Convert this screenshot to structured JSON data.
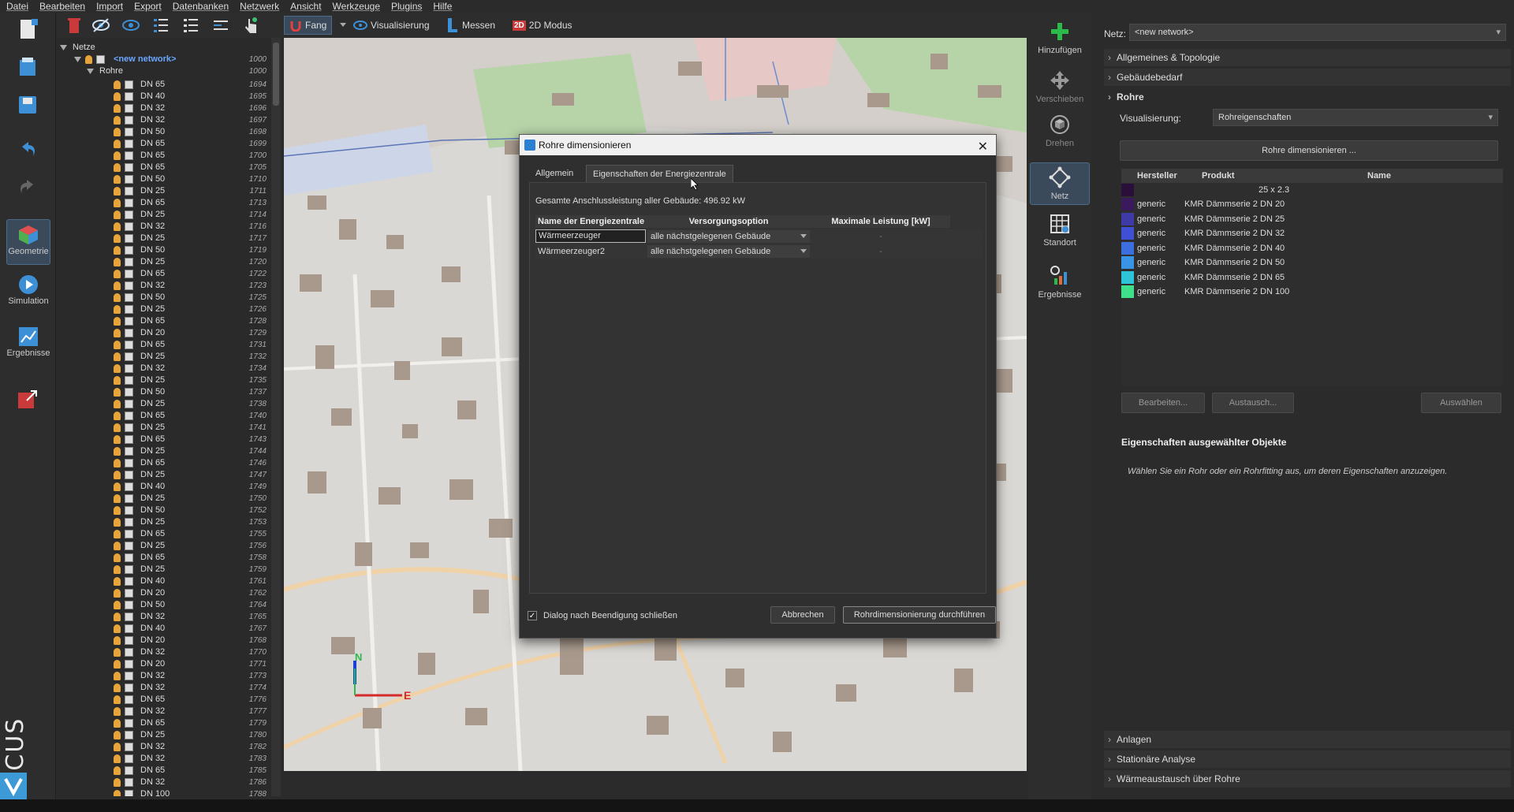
{
  "menu": [
    "Datei",
    "Bearbeiten",
    "Import",
    "Export",
    "Datenbanken",
    "Netzwerk",
    "Ansicht",
    "Werkzeuge",
    "Plugins",
    "Hilfe"
  ],
  "toolbar": {
    "fang": "Fang",
    "visualisierung": "Visualisierung",
    "messen": "Messen",
    "modus2d": "2D Modus",
    "modus2d_icon": "2D"
  },
  "leftbar": {
    "geometrie": "Geometrie",
    "simulation": "Simulation",
    "ergebnisse": "Ergebnisse",
    "brand": "VICUS"
  },
  "tree": {
    "root": "Netze",
    "network": "<new network>",
    "network_id": "1000",
    "rohre": "Rohre",
    "rohre_id": "1000",
    "items": [
      [
        "DN 65",
        "1694"
      ],
      [
        "DN 40",
        "1695"
      ],
      [
        "DN 32",
        "1696"
      ],
      [
        "DN 32",
        "1697"
      ],
      [
        "DN 50",
        "1698"
      ],
      [
        "DN 65",
        "1699"
      ],
      [
        "DN 65",
        "1700"
      ],
      [
        "DN 65",
        "1705"
      ],
      [
        "DN 50",
        "1710"
      ],
      [
        "DN 25",
        "1711"
      ],
      [
        "DN 65",
        "1713"
      ],
      [
        "DN 25",
        "1714"
      ],
      [
        "DN 32",
        "1716"
      ],
      [
        "DN 25",
        "1717"
      ],
      [
        "DN 50",
        "1719"
      ],
      [
        "DN 25",
        "1720"
      ],
      [
        "DN 65",
        "1722"
      ],
      [
        "DN 32",
        "1723"
      ],
      [
        "DN 50",
        "1725"
      ],
      [
        "DN 25",
        "1726"
      ],
      [
        "DN 65",
        "1728"
      ],
      [
        "DN 20",
        "1729"
      ],
      [
        "DN 65",
        "1731"
      ],
      [
        "DN 25",
        "1732"
      ],
      [
        "DN 32",
        "1734"
      ],
      [
        "DN 25",
        "1735"
      ],
      [
        "DN 50",
        "1737"
      ],
      [
        "DN 25",
        "1738"
      ],
      [
        "DN 65",
        "1740"
      ],
      [
        "DN 25",
        "1741"
      ],
      [
        "DN 65",
        "1743"
      ],
      [
        "DN 25",
        "1744"
      ],
      [
        "DN 65",
        "1746"
      ],
      [
        "DN 25",
        "1747"
      ],
      [
        "DN 40",
        "1749"
      ],
      [
        "DN 25",
        "1750"
      ],
      [
        "DN 50",
        "1752"
      ],
      [
        "DN 25",
        "1753"
      ],
      [
        "DN 65",
        "1755"
      ],
      [
        "DN 25",
        "1756"
      ],
      [
        "DN 65",
        "1758"
      ],
      [
        "DN 25",
        "1759"
      ],
      [
        "DN 40",
        "1761"
      ],
      [
        "DN 20",
        "1762"
      ],
      [
        "DN 50",
        "1764"
      ],
      [
        "DN 32",
        "1765"
      ],
      [
        "DN 40",
        "1767"
      ],
      [
        "DN 20",
        "1768"
      ],
      [
        "DN 32",
        "1770"
      ],
      [
        "DN 20",
        "1771"
      ],
      [
        "DN 32",
        "1773"
      ],
      [
        "DN 32",
        "1774"
      ],
      [
        "DN 65",
        "1776"
      ],
      [
        "DN 32",
        "1777"
      ],
      [
        "DN 65",
        "1779"
      ],
      [
        "DN 25",
        "1780"
      ],
      [
        "DN 32",
        "1782"
      ],
      [
        "DN 32",
        "1783"
      ],
      [
        "DN 65",
        "1785"
      ],
      [
        "DN 32",
        "1786"
      ],
      [
        "DN 100",
        "1788"
      ]
    ]
  },
  "rightsb": {
    "hinzufuegen": "Hinzufügen",
    "verschieben": "Verschieben",
    "drehen": "Drehen",
    "netz": "Netz",
    "standort": "Standort",
    "ergebnisse": "Ergebnisse"
  },
  "panel": {
    "netz_label": "Netz:",
    "netz_value": "<new network>",
    "sec1": "Allgemeines & Topologie",
    "sec2": "Gebäudebedarf",
    "sec3": "Rohre",
    "vis_label": "Visualisierung:",
    "vis_value": "Rohreigenschaften",
    "dim_button": "Rohre dimensionieren ...",
    "cols": [
      "Hersteller",
      "Produkt",
      "Name"
    ],
    "first_name": "25 x 2.3",
    "pipes": [
      {
        "color": "#3a1a5c",
        "h": "generic",
        "p": "KMR Dämmserie 2",
        "n": "DN 20"
      },
      {
        "color": "#3f3aa8",
        "h": "generic",
        "p": "KMR Dämmserie 2",
        "n": "DN 25"
      },
      {
        "color": "#3f4fd6",
        "h": "generic",
        "p": "KMR Dämmserie 2",
        "n": "DN 32"
      },
      {
        "color": "#3b6fe0",
        "h": "generic",
        "p": "KMR Dämmserie 2",
        "n": "DN 40"
      },
      {
        "color": "#3a94e6",
        "h": "generic",
        "p": "KMR Dämmserie 2",
        "n": "DN 50"
      },
      {
        "color": "#2fc3d8",
        "h": "generic",
        "p": "KMR Dämmserie 2",
        "n": "DN 65"
      },
      {
        "color": "#3ee08a",
        "h": "generic",
        "p": "KMR Dämmserie 2",
        "n": "DN 100"
      }
    ],
    "edit": "Bearbeiten...",
    "exchange": "Austausch...",
    "select": "Auswählen",
    "props_title": "Eigenschaften ausgewählter Objekte",
    "props_hint": "Wählen Sie ein Rohr oder ein Rohrfitting aus, um deren Eigenschaften anzuzeigen.",
    "sec4": "Anlagen",
    "sec5": "Stationäre Analyse",
    "sec6": "Wärmeaustausch über Rohre"
  },
  "map": {
    "north": "N",
    "east": "E"
  },
  "dialog": {
    "title": "Rohre dimensionieren",
    "tab1": "Allgemein",
    "tab2": "Eigenschaften der Energiezentrale",
    "total": "Gesamte Anschlussleistung aller Gebäude: 496.92  kW",
    "cols": [
      "Name der Energiezentrale",
      "Versorgungsoption",
      "Maximale Leistung [kW]"
    ],
    "rows": [
      {
        "name": "Wärmeerzeuger",
        "option": "alle nächstgelegenen Gebäude",
        "max": "-"
      },
      {
        "name": "Wärmeerzeuger2",
        "option": "alle nächstgelegenen Gebäude",
        "max": "-"
      }
    ],
    "close_label": "Dialog nach Beendigung schließen",
    "cancel": "Abbrechen",
    "run": "Rohrdimensionierung durchführen"
  }
}
